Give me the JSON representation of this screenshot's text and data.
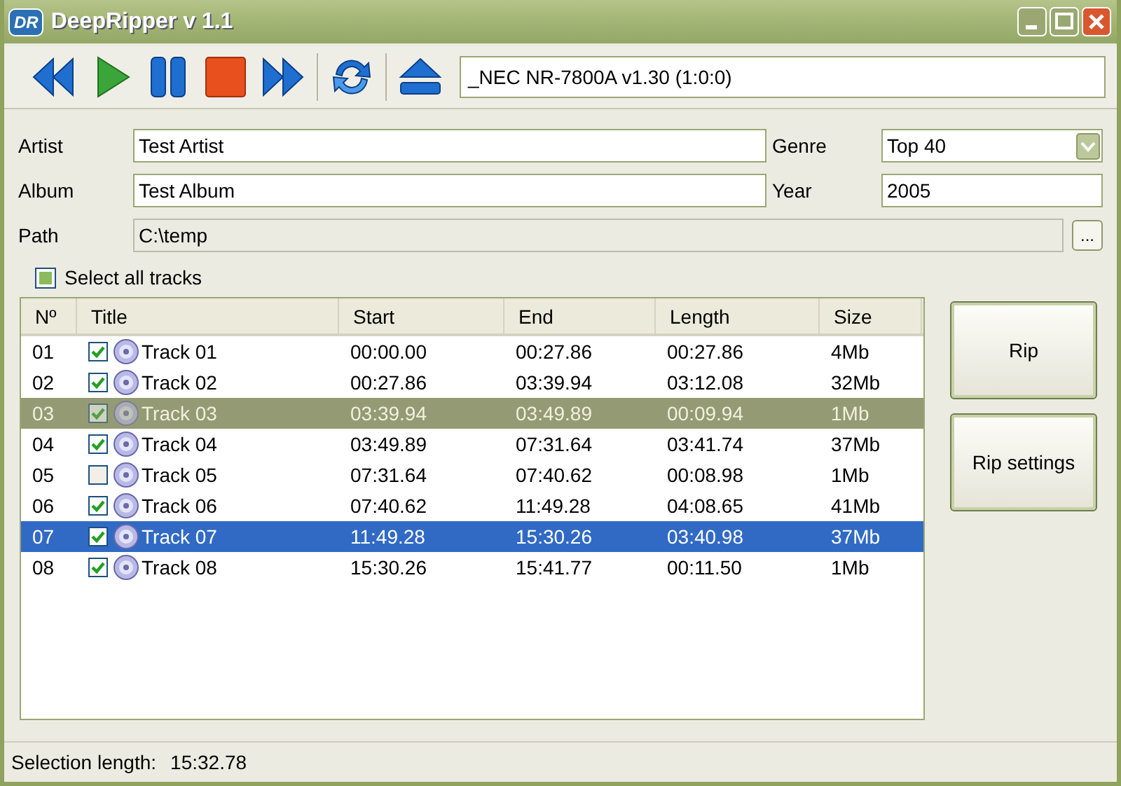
{
  "window": {
    "title": "DeepRipper v 1.1",
    "logo": "DR"
  },
  "toolbar": {
    "drive": "_NEC NR-7800A v1.30 (1:0:0)"
  },
  "form": {
    "artist_label": "Artist",
    "artist": "Test Artist",
    "album_label": "Album",
    "album": "Test Album",
    "path_label": "Path",
    "path": "C:\\temp",
    "browse": "...",
    "genre_label": "Genre",
    "genre": "Top 40",
    "year_label": "Year",
    "year": "2005"
  },
  "select_all": {
    "label": "Select all tracks",
    "checked": false
  },
  "table": {
    "columns": [
      "Nº",
      "Title",
      "Start",
      "End",
      "Length",
      "Size"
    ],
    "rows": [
      {
        "cells": [
          "01",
          "Track 01",
          "00:00.00",
          "00:27.86",
          "00:27.86",
          "4Mb"
        ],
        "checked": true,
        "selected": false,
        "dimmed": false
      },
      {
        "cells": [
          "02",
          "Track 02",
          "00:27.86",
          "03:39.94",
          "03:12.08",
          "32Mb"
        ],
        "checked": true,
        "selected": false,
        "dimmed": false
      },
      {
        "cells": [
          "03",
          "Track 03",
          "03:39.94",
          "03:49.89",
          "00:09.94",
          "1Mb"
        ],
        "checked": true,
        "selected": false,
        "dimmed": true
      },
      {
        "cells": [
          "04",
          "Track 04",
          "03:49.89",
          "07:31.64",
          "03:41.74",
          "37Mb"
        ],
        "checked": true,
        "selected": false,
        "dimmed": false
      },
      {
        "cells": [
          "05",
          "Track 05",
          "07:31.64",
          "07:40.62",
          "00:08.98",
          "1Mb"
        ],
        "checked": false,
        "selected": false,
        "dimmed": false
      },
      {
        "cells": [
          "06",
          "Track 06",
          "07:40.62",
          "11:49.28",
          "04:08.65",
          "41Mb"
        ],
        "checked": true,
        "selected": false,
        "dimmed": false
      },
      {
        "cells": [
          "07",
          "Track 07",
          "11:49.28",
          "15:30.26",
          "03:40.98",
          "37Mb"
        ],
        "checked": true,
        "selected": true,
        "dimmed": false
      },
      {
        "cells": [
          "08",
          "Track 08",
          "15:30.26",
          "15:41.77",
          "00:11.50",
          "1Mb"
        ],
        "checked": true,
        "selected": false,
        "dimmed": false
      }
    ]
  },
  "buttons": [
    "Rip",
    "Rip settings"
  ],
  "status_bar": {
    "label": "Selection length:",
    "value": "15:32.78"
  }
}
